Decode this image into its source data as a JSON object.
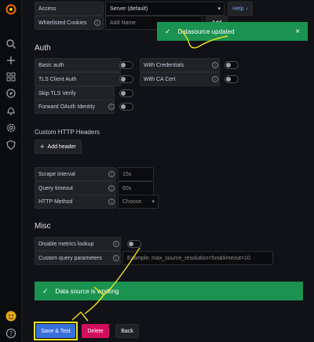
{
  "sidebar": {
    "icons": [
      "grafana-logo-icon",
      "search-icon",
      "plus-icon",
      "dashboards-icon",
      "explore-compass-icon",
      "alert-bell-icon",
      "gear-icon",
      "shield-icon"
    ],
    "avatar": "user-avatar-icon",
    "help": "help-icon"
  },
  "top": {
    "access_label": "Access",
    "access_value": "Server (default)",
    "help_label": "Help",
    "cookies_label": "Whitelisted Cookies",
    "cookies_placeholder": "Add Name",
    "add_label": "Add"
  },
  "auth": {
    "title": "Auth",
    "basic_auth": "Basic auth",
    "with_credentials": "With Credentials",
    "tls_client_auth": "TLS Client Auth",
    "with_ca_cert": "With CA Cert",
    "skip_tls_verify": "Skip TLS Verify",
    "forward_oauth": "Forward OAuth Identity"
  },
  "headers": {
    "title": "Custom HTTP Headers",
    "add_header": "Add header"
  },
  "prometheus": {
    "scrape_interval_label": "Scrape interval",
    "scrape_interval_placeholder": "15s",
    "query_timeout_label": "Query timeout",
    "query_timeout_placeholder": "60s",
    "http_method_label": "HTTP Method",
    "http_method_placeholder": "Choose"
  },
  "misc": {
    "title": "Misc",
    "disable_metrics_label": "Disable metrics lookup",
    "custom_query_label": "Custom query parameters",
    "custom_query_placeholder": "Example: max_source_resolution=5m&timeout=10"
  },
  "toasts": {
    "updated": "Datasource updated",
    "close": "×",
    "working": "Data source is working"
  },
  "buttons": {
    "save_test": "Save & Test",
    "delete": "Delete",
    "back": "Back"
  },
  "colors": {
    "success": "#1a9250",
    "primary": "#3871dc",
    "danger": "#d10e5c",
    "annotation": "#f2e21b"
  }
}
